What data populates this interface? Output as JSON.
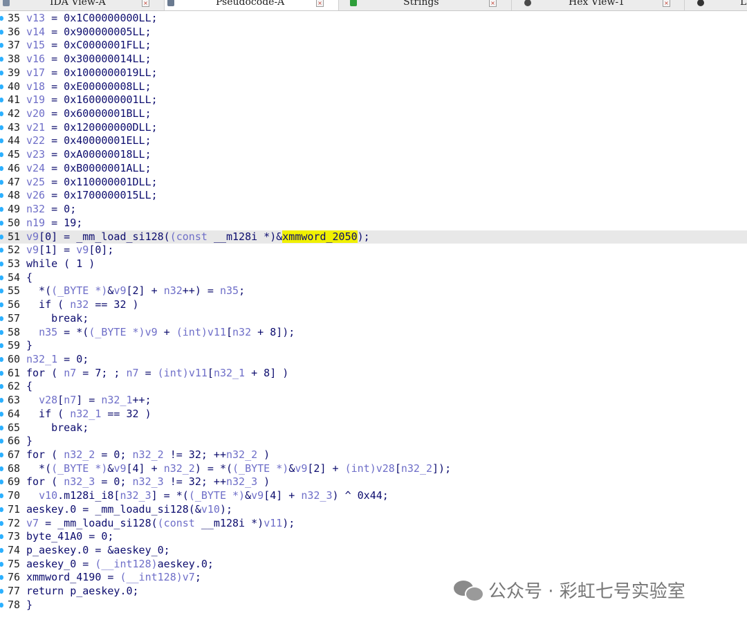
{
  "tabs": [
    {
      "label": "IDA View-A",
      "icon": "ida-view-icon",
      "active": false
    },
    {
      "label": "Pseudocode-A",
      "icon": "pseudocode-icon",
      "active": true
    },
    {
      "label": "Strings",
      "icon": "strings-icon",
      "active": false
    },
    {
      "label": "Hex View-1",
      "icon": "hex-view-icon",
      "active": false
    },
    {
      "label": "Lo",
      "icon": "locals-icon",
      "active": false
    }
  ],
  "tab_close_glyph": "×",
  "highlight_line": 51,
  "highlight_word": "xmmword_2050",
  "code_lines": [
    {
      "n": "35",
      "text": "v13 = 0x1C00000000LL;"
    },
    {
      "n": "36",
      "text": "v14 = 0x900000005LL;"
    },
    {
      "n": "37",
      "text": "v15 = 0xC0000001FLL;"
    },
    {
      "n": "38",
      "text": "v16 = 0x300000014LL;"
    },
    {
      "n": "39",
      "text": "v17 = 0x1000000019LL;"
    },
    {
      "n": "40",
      "text": "v18 = 0xE00000008LL;"
    },
    {
      "n": "41",
      "text": "v19 = 0x1600000001LL;"
    },
    {
      "n": "42",
      "text": "v20 = 0x60000001BLL;"
    },
    {
      "n": "43",
      "text": "v21 = 0x120000000DLL;"
    },
    {
      "n": "44",
      "text": "v22 = 0x40000001ELL;"
    },
    {
      "n": "45",
      "text": "v23 = 0xA00000018LL;"
    },
    {
      "n": "46",
      "text": "v24 = 0xB0000001ALL;"
    },
    {
      "n": "47",
      "text": "v25 = 0x110000001DLL;"
    },
    {
      "n": "48",
      "text": "v26 = 0x1700000015LL;"
    },
    {
      "n": "49",
      "text": "n32 = 0;"
    },
    {
      "n": "50",
      "text": "n19 = 19;"
    },
    {
      "n": "51",
      "text": "v9[0] = _mm_load_si128((const __m128i *)&xmmword_2050);"
    },
    {
      "n": "52",
      "text": "v9[1] = v9[0];"
    },
    {
      "n": "53",
      "text": "while ( 1 )"
    },
    {
      "n": "54",
      "text": "{"
    },
    {
      "n": "55",
      "text": "  *((_BYTE *)&v9[2] + n32++) = n35;"
    },
    {
      "n": "56",
      "text": "  if ( n32 == 32 )"
    },
    {
      "n": "57",
      "text": "    break;"
    },
    {
      "n": "58",
      "text": "  n35 = *((_BYTE *)v9 + (int)v11[n32 + 8]);"
    },
    {
      "n": "59",
      "text": "}"
    },
    {
      "n": "60",
      "text": "n32_1 = 0;"
    },
    {
      "n": "61",
      "text": "for ( n7 = 7; ; n7 = (int)v11[n32_1 + 8] )"
    },
    {
      "n": "62",
      "text": "{"
    },
    {
      "n": "63",
      "text": "  v28[n7] = n32_1++;"
    },
    {
      "n": "64",
      "text": "  if ( n32_1 == 32 )"
    },
    {
      "n": "65",
      "text": "    break;"
    },
    {
      "n": "66",
      "text": "}"
    },
    {
      "n": "67",
      "text": "for ( n32_2 = 0; n32_2 != 32; ++n32_2 )"
    },
    {
      "n": "68",
      "text": "  *((_BYTE *)&v9[4] + n32_2) = *((_BYTE *)&v9[2] + (int)v28[n32_2]);"
    },
    {
      "n": "69",
      "text": "for ( n32_3 = 0; n32_3 != 32; ++n32_3 )"
    },
    {
      "n": "70",
      "text": "  v10.m128i_i8[n32_3] = *((_BYTE *)&v9[4] + n32_3) ^ 0x44;"
    },
    {
      "n": "71",
      "text": "aeskey.0 = _mm_loadu_si128(&v10);"
    },
    {
      "n": "72",
      "text": "v7 = _mm_loadu_si128((const __m128i *)v11);"
    },
    {
      "n": "73",
      "text": "byte_41A0 = 0;"
    },
    {
      "n": "74",
      "text": "p_aeskey.0 = &aeskey_0;"
    },
    {
      "n": "75",
      "text": "aeskey_0 = (__int128)aeskey.0;"
    },
    {
      "n": "76",
      "text": "xmmword_4190 = (__int128)v7;"
    },
    {
      "n": "77",
      "text": "return p_aeskey.0;"
    },
    {
      "n": "78",
      "text": "}"
    }
  ],
  "watermark": {
    "icon": "wechat-icon",
    "text": "公众号 · 彩虹七号实验室"
  }
}
